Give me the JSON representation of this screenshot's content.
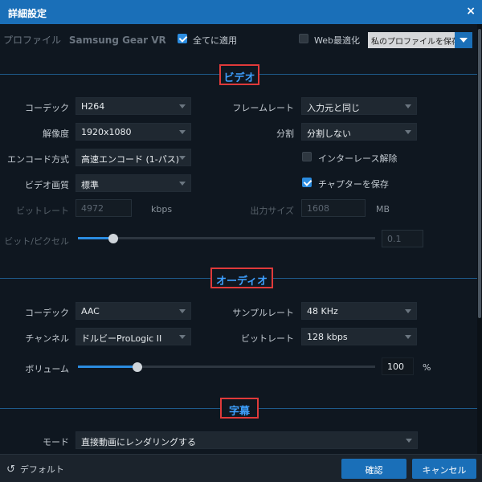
{
  "window": {
    "title": "詳細設定",
    "close": "×"
  },
  "profile": {
    "label": "プロファイル",
    "name": "Samsung Gear VR",
    "apply_all": {
      "label": "全てに適用",
      "checked": true
    },
    "web_optimize": {
      "label": "Web最適化",
      "checked": false
    },
    "save_select": "私のプロファイルを保存"
  },
  "video": {
    "section_title": "ビデオ",
    "codec": {
      "label": "コーデック",
      "value": "H264"
    },
    "framerate": {
      "label": "フレームレート",
      "value": "入力元と同じ"
    },
    "resolution": {
      "label": "解像度",
      "value": "1920x1080"
    },
    "split": {
      "label": "分割",
      "value": "分割しない"
    },
    "encode_method": {
      "label": "エンコード方式",
      "value": "高速エンコード (1-パス)"
    },
    "deinterlace": {
      "label": "インターレース解除",
      "checked": false
    },
    "quality": {
      "label": "ビデオ画質",
      "value": "標準"
    },
    "save_chapters": {
      "label": "チャプターを保存",
      "checked": true
    },
    "bitrate": {
      "label": "ビットレート",
      "value": "4972",
      "unit": "kbps"
    },
    "output_size": {
      "label": "出力サイズ",
      "value": "1608",
      "unit": "MB"
    },
    "bits_per_pixel": {
      "label": "ビット/ピクセル",
      "value": "0.1",
      "level": 0.12
    }
  },
  "audio": {
    "section_title": "オーディオ",
    "codec": {
      "label": "コーデック",
      "value": "AAC"
    },
    "samplerate": {
      "label": "サンプルレート",
      "value": "48 KHz"
    },
    "channel": {
      "label": "チャンネル",
      "value": "ドルビーProLogic II"
    },
    "bitrate": {
      "label": "ビットレート",
      "value": "128 kbps"
    },
    "volume": {
      "label": "ボリューム",
      "value": "100",
      "unit": "%",
      "level": 0.2
    }
  },
  "subtitle": {
    "section_title": "字幕",
    "mode": {
      "label": "モード",
      "value": "直接動画にレンダリングする"
    }
  },
  "footer": {
    "default_label": "デフォルト",
    "ok_label": "確認",
    "cancel_label": "キャンセル"
  }
}
